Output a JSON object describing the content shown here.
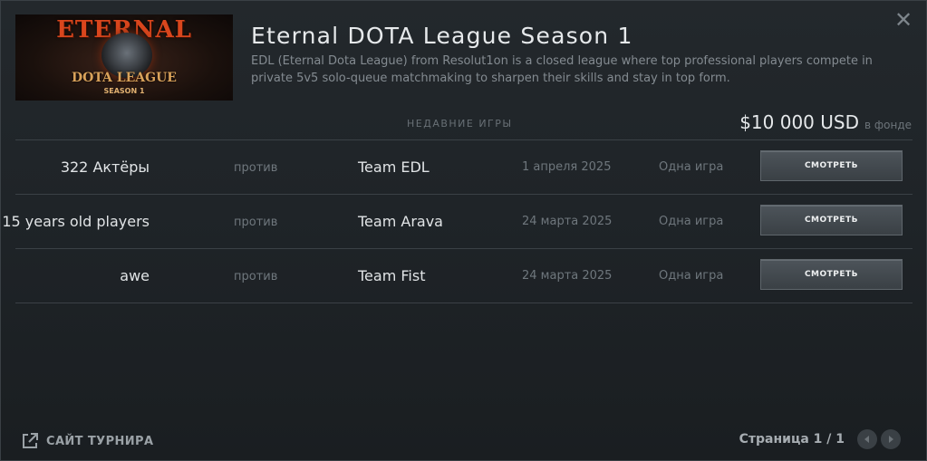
{
  "dialog": {
    "close_symbol": "✕"
  },
  "league": {
    "logo": {
      "top_text": "ETERNAL",
      "middle_text": "DOTA LEAGUE",
      "bottom_text": "SEASON 1"
    },
    "title": "Eternal DOTA League Season 1",
    "description": "EDL (Eternal Dota League) from Resolut1on is a closed league where top professional players compete in private 5v5 solo-queue matchmaking to sharpen their skills and stay in top form."
  },
  "recent_games": {
    "label": "НЕДАВНИЕ ИГРЫ",
    "prize_amount": "$10 000 USD",
    "prize_suffix": "в фонде",
    "rows": [
      {
        "team1": "322 Актёры",
        "vs": "против",
        "team2": "Team EDL",
        "date": "1 апреля 2025",
        "games": "Одна игра",
        "watch_label": "СМОТРЕТЬ"
      },
      {
        "team1": "15 years old players",
        "vs": "против",
        "team2": "Team Arava",
        "date": "24 марта 2025",
        "games": "Одна игра",
        "watch_label": "СМОТРЕТЬ"
      },
      {
        "team1": "awe",
        "vs": "против",
        "team2": "Team Fist",
        "date": "24 марта 2025",
        "games": "Одна игра",
        "watch_label": "СМОТРЕТЬ"
      }
    ]
  },
  "footer": {
    "site_link_label": "САЙТ ТУРНИРА",
    "site_icon": "external-link-icon",
    "page_label": "Страница 1 / 1"
  }
}
